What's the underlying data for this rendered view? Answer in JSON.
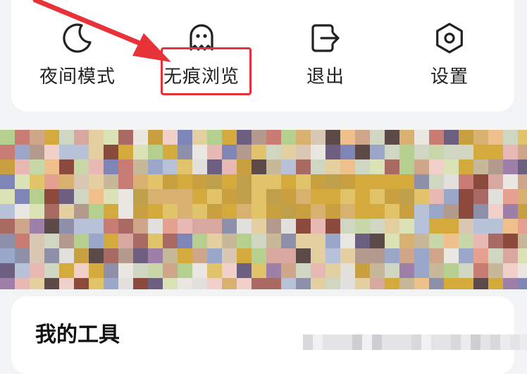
{
  "menu": {
    "items": [
      {
        "label": "夜间模式",
        "icon": "moon-icon"
      },
      {
        "label": "无痕浏览",
        "icon": "ghost-icon"
      },
      {
        "label": "退出",
        "icon": "logout-icon"
      },
      {
        "label": "设置",
        "icon": "settings-hexagon-icon"
      }
    ],
    "highlighted_item": "无痕浏览"
  },
  "annotation": {
    "color": "#e8323a"
  },
  "banner": {
    "content": "pixelated-image"
  },
  "tools": {
    "title": "我的工具"
  }
}
